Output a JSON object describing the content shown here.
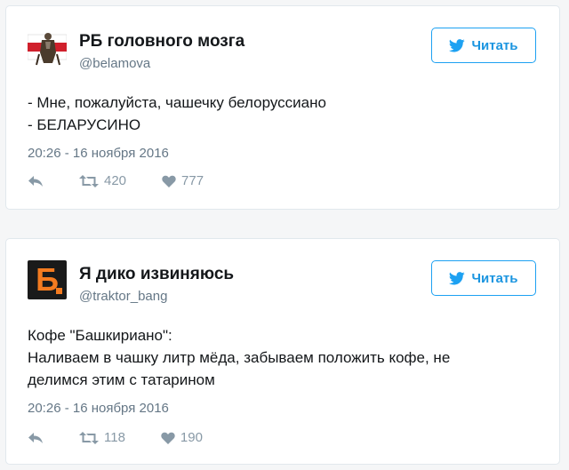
{
  "tweets": [
    {
      "author": {
        "name": "РБ головного мозга",
        "handle": "@belamova",
        "avatar": "white-red-white-flag-with-knight"
      },
      "follow_label": "Читать",
      "text_lines": [
        "- Мне, пожалуйста, чашечку белоруссиано",
        "- БЕЛАРУСИНО"
      ],
      "timestamp": "20:26 - 16 ноября 2016",
      "retweets": "420",
      "likes": "777"
    },
    {
      "author": {
        "name": "Я дико извиняюсь",
        "handle": "@traktor_bang",
        "avatar": "orange-letter-b-logo"
      },
      "follow_label": "Читать",
      "text_lines": [
        "Кофе \"Башкириано\":",
        "Наливаем в чашку литр мёда, забываем положить кофе, не",
        "делимся этим с татарином"
      ],
      "timestamp": "20:26 - 16 ноября 2016",
      "retweets": "118",
      "likes": "190"
    }
  ],
  "colors": {
    "accent": "#1da1f2",
    "muted": "#8899a6",
    "handle": "#657786",
    "logo_orange": "#f47b20"
  }
}
